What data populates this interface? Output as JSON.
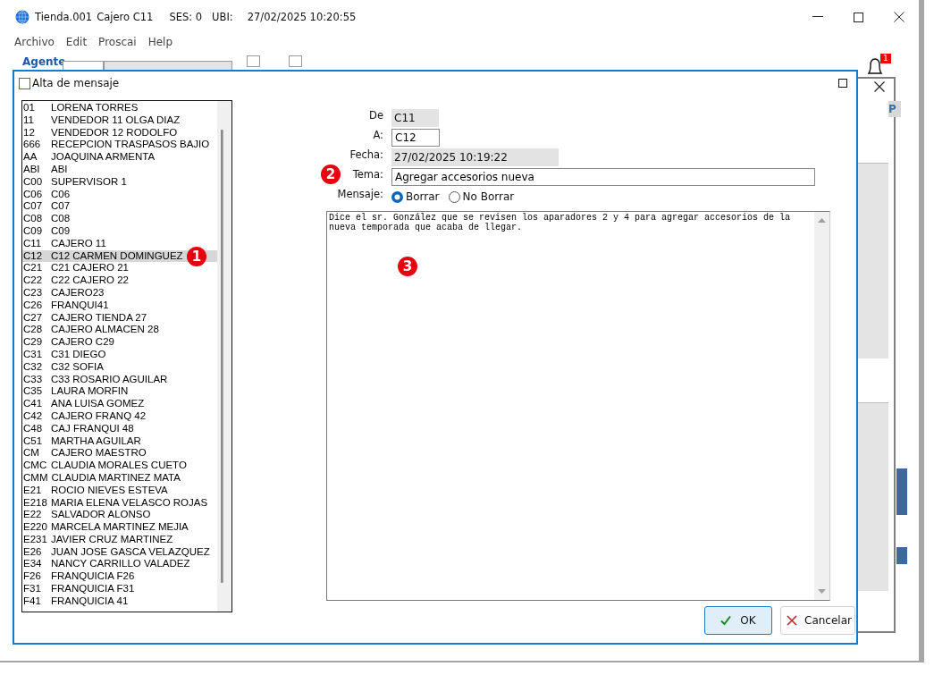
{
  "window": {
    "title_parts": [
      "Tienda.001",
      "Cajero C11",
      "SES: 0",
      "UBI:",
      "27/02/2025 10:20:55"
    ]
  },
  "menu": [
    "Archivo",
    "Edit",
    "Proscai",
    "Help"
  ],
  "background": {
    "agent_label": "Agente",
    "checkboxes": [
      {
        "checked": false
      },
      {
        "checked": false
      }
    ],
    "notification_count": "1",
    "column_header": "P"
  },
  "dialog": {
    "title": "Alta de mensaje",
    "recipients": [
      {
        "code": "01",
        "name": "LORENA TORRES",
        "selected": false
      },
      {
        "code": "11",
        "name": "VENDEDOR 11 OLGA DIAZ",
        "selected": false
      },
      {
        "code": "12",
        "name": "VENDEDOR 12 RODOLFO",
        "selected": false
      },
      {
        "code": "666",
        "name": "RECEPCION TRASPASOS BAJIO",
        "selected": false
      },
      {
        "code": "AA",
        "name": "JOAQUINA ARMENTA",
        "selected": false
      },
      {
        "code": "ABI",
        "name": "ABI",
        "selected": false
      },
      {
        "code": "C00",
        "name": "SUPERVISOR 1",
        "selected": false
      },
      {
        "code": "C06",
        "name": "C06",
        "selected": false
      },
      {
        "code": "C07",
        "name": "C07",
        "selected": false
      },
      {
        "code": "C08",
        "name": "C08",
        "selected": false
      },
      {
        "code": "C09",
        "name": "C09",
        "selected": false
      },
      {
        "code": "C11",
        "name": "CAJERO 11",
        "selected": false
      },
      {
        "code": "C12",
        "name": "C12 CARMEN DOMINGUEZ",
        "selected": true,
        "marker": "1"
      },
      {
        "code": "C21",
        "name": "C21 CAJERO 21",
        "selected": false
      },
      {
        "code": "C22",
        "name": "C22 CAJERO 22",
        "selected": false
      },
      {
        "code": "C23",
        "name": "CAJERO23",
        "selected": false
      },
      {
        "code": "C26",
        "name": "FRANQUI41",
        "selected": false
      },
      {
        "code": "C27",
        "name": "CAJERO TIENDA 27",
        "selected": false
      },
      {
        "code": "C28",
        "name": "CAJERO ALMACEN 28",
        "selected": false
      },
      {
        "code": "C29",
        "name": "CAJERO C29",
        "selected": false
      },
      {
        "code": "C31",
        "name": "C31 DIEGO",
        "selected": false
      },
      {
        "code": "C32",
        "name": "C32 SOFIA",
        "selected": false
      },
      {
        "code": "C33",
        "name": "C33 ROSARIO AGUILAR",
        "selected": false
      },
      {
        "code": "C35",
        "name": "LAURA MORFIN",
        "selected": false
      },
      {
        "code": "C41",
        "name": "ANA LUISA GOMEZ",
        "selected": false
      },
      {
        "code": "C42",
        "name": "CAJERO FRANQ 42",
        "selected": false
      },
      {
        "code": "C48",
        "name": "CAJ FRANQUI 48",
        "selected": false
      },
      {
        "code": "C51",
        "name": "MARTHA AGUILAR",
        "selected": false
      },
      {
        "code": "CM",
        "name": "CAJERO MAESTRO",
        "selected": false
      },
      {
        "code": "CMC",
        "name": "CLAUDIA MORALES CUETO",
        "selected": false
      },
      {
        "code": "CMM",
        "name": "CLAUDIA MARTINEZ MATA",
        "selected": false
      },
      {
        "code": "E21",
        "name": "ROCIO NIEVES ESTEVA",
        "selected": false
      },
      {
        "code": "E218",
        "name": "MARIA ELENA VELASCO ROJAS",
        "selected": false
      },
      {
        "code": "E22",
        "name": "SALVADOR ALONSO",
        "selected": false
      },
      {
        "code": "E220",
        "name": "MARCELA MARTINEZ MEJIA",
        "selected": false
      },
      {
        "code": "E231",
        "name": "JAVIER CRUZ MARTINEZ",
        "selected": false
      },
      {
        "code": "E26",
        "name": "JUAN JOSE GASCA VELAZQUEZ",
        "selected": false
      },
      {
        "code": "E34",
        "name": "NANCY CARRILLO VALADEZ",
        "selected": false
      },
      {
        "code": "F26",
        "name": "FRANQUICIA F26",
        "selected": false
      },
      {
        "code": "F31",
        "name": "FRANQUICIA F31",
        "selected": false
      },
      {
        "code": "F41",
        "name": "FRANQUICIA 41",
        "selected": false
      }
    ],
    "form": {
      "de_label": "De",
      "de_value": "C11",
      "a_label": "A:",
      "a_value": "C12",
      "fecha_label": "Fecha:",
      "fecha_value": "27/02/2025 10:19:22",
      "tema_label": "Tema:",
      "tema_value": "Agregar accesorios nueva",
      "tema_marker": "2",
      "mensaje_label": "Mensaje:",
      "mensaje_options": [
        {
          "label": "Borrar",
          "selected": true
        },
        {
          "label": "No Borrar",
          "selected": false
        }
      ],
      "body": "Dice el sr. González que se revisen los aparadores 2 y 4 para agregar accesorios de la nueva temporada que acaba de llegar.",
      "body_marker": "3"
    },
    "buttons": [
      {
        "kind": "ok",
        "label": "OK"
      },
      {
        "kind": "cancel",
        "label": "Cancelar"
      }
    ]
  }
}
